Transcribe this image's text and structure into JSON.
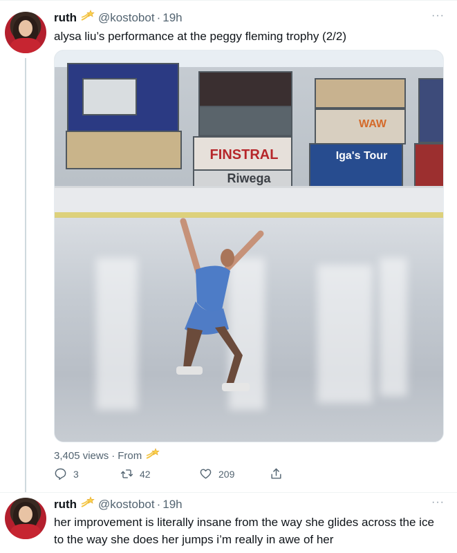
{
  "tweets": [
    {
      "name": "ruth",
      "handle": "@kostobot",
      "separator": "·",
      "time": "19h",
      "more": "···",
      "text": "alysa liu’s performance at the peggy fleming trophy (2/2)",
      "media": {
        "signs": [
          "FINSTRAL",
          "Riwega",
          "Iga's Tour",
          "WAW"
        ]
      },
      "views": "3,405 views",
      "from_label": "From",
      "counts": {
        "replies": "3",
        "retweets": "42",
        "likes": "209"
      }
    },
    {
      "name": "ruth",
      "handle": "@kostobot",
      "separator": "·",
      "time": "19h",
      "more": "···",
      "text": "her improvement is literally insane from the way she glides across the ice to the way she does her jumps i’m really in awe of her"
    }
  ],
  "icons": {
    "badge": "shooting-star-icon",
    "reply": "reply-icon",
    "retweet": "retweet-icon",
    "like": "heart-icon",
    "share": "share-icon"
  },
  "colors": {
    "text": "#0f1419",
    "secondary": "#536471",
    "badge": "#f4c542"
  }
}
